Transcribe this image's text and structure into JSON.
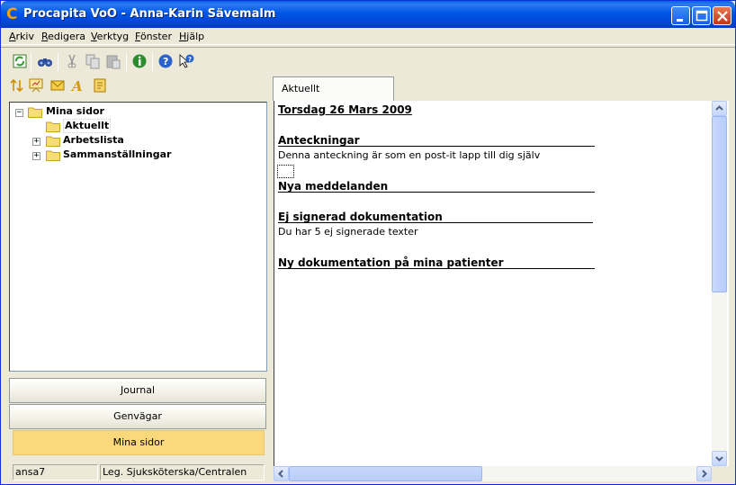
{
  "window": {
    "title": "Procapita VoO - Anna-Karin Sävemalm",
    "app_icon": "C"
  },
  "menu": [
    {
      "accel": "A",
      "rest": "rkiv"
    },
    {
      "accel": "R",
      "rest": "edigera"
    },
    {
      "accel": "V",
      "rest": "erktyg"
    },
    {
      "accel": "F",
      "rest": "önster"
    },
    {
      "accel": "H",
      "rest": "jälp"
    }
  ],
  "toolbar_icons": [
    "refresh-icon",
    "binoculars-icon",
    "cut-icon",
    "copy-icon",
    "paste-icon",
    "info-icon",
    "help-icon",
    "whats-this-icon"
  ],
  "left_toolbar_icons": [
    "sort-icon",
    "presentation-icon",
    "envelope-icon",
    "font-icon",
    "note-icon"
  ],
  "tree": {
    "root": "Mina sidor",
    "children": [
      "Aktuellt",
      "Arbetslista",
      "Sammanställningar"
    ]
  },
  "nav_buttons": {
    "journal": "Journal",
    "genvagar": "Genvägar",
    "mina_sidor": "Mina sidor"
  },
  "status": {
    "user": "ansa7",
    "role": "Leg. Sjuksköterska/Centralen"
  },
  "tab": {
    "label": "Aktuellt"
  },
  "content": {
    "date": "Torsdag 26 Mars 2009",
    "anteckningar_heading": "Anteckningar",
    "anteckningar_text": "Denna anteckning är som en post-it lapp till dig själv",
    "nya_meddelanden_heading": "Nya meddelanden",
    "ej_signerad_heading": "Ej signerad dokumentation",
    "ej_signerad_text": "Du har 5 ej signerade texter",
    "ny_dokumentation_heading": "Ny dokumentation på mina patienter"
  },
  "colors": {
    "titlebar": "#0055e5",
    "active_nav": "#fcd87d",
    "app_icon": "#f5a100"
  }
}
